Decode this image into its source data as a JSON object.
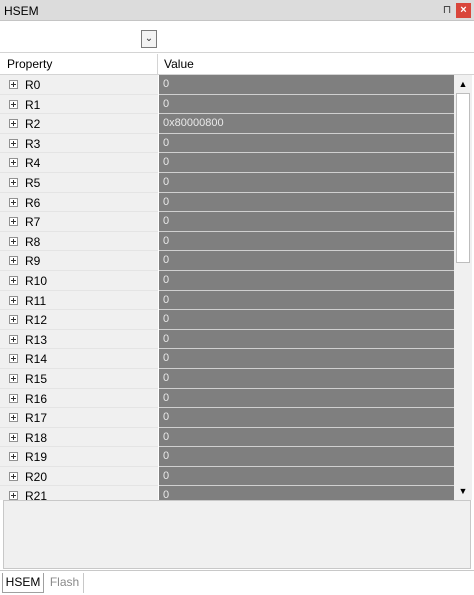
{
  "window": {
    "title": "HSEM",
    "pin_glyph": "⊓",
    "close_glyph": "×"
  },
  "toolbar": {
    "selector_value": "",
    "dropdown_glyph": "⌄"
  },
  "columns": {
    "property": "Property",
    "value": "Value"
  },
  "rows": [
    {
      "name": "R0",
      "value": "0"
    },
    {
      "name": "R1",
      "value": "0"
    },
    {
      "name": "R2",
      "value": "0x80000800"
    },
    {
      "name": "R3",
      "value": "0"
    },
    {
      "name": "R4",
      "value": "0"
    },
    {
      "name": "R5",
      "value": "0"
    },
    {
      "name": "R6",
      "value": "0"
    },
    {
      "name": "R7",
      "value": "0"
    },
    {
      "name": "R8",
      "value": "0"
    },
    {
      "name": "R9",
      "value": "0"
    },
    {
      "name": "R10",
      "value": "0"
    },
    {
      "name": "R11",
      "value": "0"
    },
    {
      "name": "R12",
      "value": "0"
    },
    {
      "name": "R13",
      "value": "0"
    },
    {
      "name": "R14",
      "value": "0"
    },
    {
      "name": "R15",
      "value": "0"
    },
    {
      "name": "R16",
      "value": "0"
    },
    {
      "name": "R17",
      "value": "0"
    },
    {
      "name": "R18",
      "value": "0"
    },
    {
      "name": "R19",
      "value": "0"
    },
    {
      "name": "R20",
      "value": "0"
    },
    {
      "name": "R21",
      "value": "0"
    }
  ],
  "scrollbar": {
    "up_glyph": "▲",
    "down_glyph": "▼"
  },
  "tabs": [
    {
      "label": "HSEM",
      "active": true
    },
    {
      "label": "Flash",
      "active": false
    }
  ],
  "colors": {
    "value_cell_bg": "#7f7f7f",
    "property_cell_bg": "#f0f0f0",
    "close_button": "#d9463b"
  },
  "icons": {
    "row_expander": "plus-box-icon",
    "pin": "pin-icon",
    "close": "close-icon",
    "dropdown": "chevron-down-icon"
  }
}
